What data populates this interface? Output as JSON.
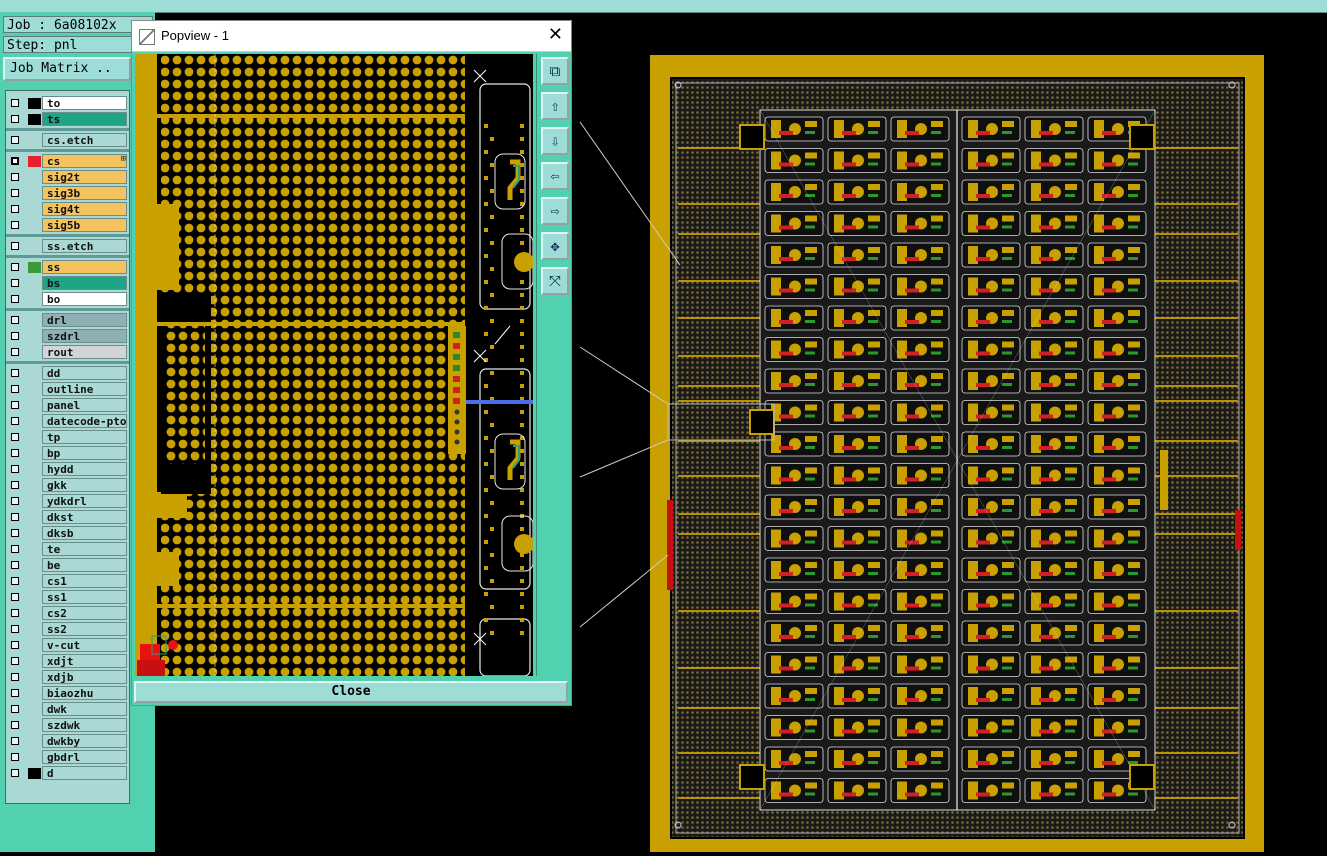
{
  "job_label": "Job : 6a08102x",
  "step_label": "Step: pnl",
  "job_matrix_button": "Job Matrix ..",
  "layers": [
    {
      "name": "to",
      "color": "#ffffff",
      "swatch": "#000000",
      "checked": false
    },
    {
      "name": "ts",
      "color": "#1ea586",
      "swatch": "#000000",
      "checked": false
    },
    {
      "name": "cs.etch",
      "color": "#a9d8d5",
      "swatch": "",
      "checked": false
    },
    {
      "name": "cs",
      "color": "#f5c260",
      "swatch": "#e8202b",
      "checked": true
    },
    {
      "name": "sig2t",
      "color": "#f5c260",
      "swatch": "",
      "checked": false
    },
    {
      "name": "sig3b",
      "color": "#f5c260",
      "swatch": "",
      "checked": false
    },
    {
      "name": "sig4t",
      "color": "#f5c260",
      "swatch": "",
      "checked": false
    },
    {
      "name": "sig5b",
      "color": "#f5c260",
      "swatch": "",
      "checked": false
    },
    {
      "name": "ss.etch",
      "color": "#a9d8d5",
      "swatch": "",
      "checked": false
    },
    {
      "name": "ss",
      "color": "#f5c260",
      "swatch": "#3a9a3a",
      "checked": false
    },
    {
      "name": "bs",
      "color": "#1ea586",
      "swatch": "",
      "checked": false
    },
    {
      "name": "bo",
      "color": "#ffffff",
      "swatch": "",
      "checked": false
    },
    {
      "name": "drl",
      "color": "#8fb0b4",
      "swatch": "",
      "checked": false
    },
    {
      "name": "szdrl",
      "color": "#8fb0b4",
      "swatch": "",
      "checked": false
    },
    {
      "name": "rout",
      "color": "#d4d4d4",
      "swatch": "",
      "checked": false
    },
    {
      "name": "dd",
      "color": "#a9d8d5",
      "swatch": "",
      "checked": false
    },
    {
      "name": "outline",
      "color": "#a9d8d5",
      "swatch": "",
      "checked": false
    },
    {
      "name": "panel",
      "color": "#a9d8d5",
      "swatch": "",
      "checked": false
    },
    {
      "name": "datecode-pto",
      "color": "#a9d8d5",
      "swatch": "",
      "checked": false
    },
    {
      "name": "tp",
      "color": "#a9d8d5",
      "swatch": "",
      "checked": false
    },
    {
      "name": "bp",
      "color": "#a9d8d5",
      "swatch": "",
      "checked": false
    },
    {
      "name": "hydd",
      "color": "#a9d8d5",
      "swatch": "",
      "checked": false
    },
    {
      "name": "gkk",
      "color": "#a9d8d5",
      "swatch": "",
      "checked": false
    },
    {
      "name": "ydkdrl",
      "color": "#a9d8d5",
      "swatch": "",
      "checked": false
    },
    {
      "name": "dkst",
      "color": "#a9d8d5",
      "swatch": "",
      "checked": false
    },
    {
      "name": "dksb",
      "color": "#a9d8d5",
      "swatch": "",
      "checked": false
    },
    {
      "name": "te",
      "color": "#a9d8d5",
      "swatch": "",
      "checked": false
    },
    {
      "name": "be",
      "color": "#a9d8d5",
      "swatch": "",
      "checked": false
    },
    {
      "name": "cs1",
      "color": "#a9d8d5",
      "swatch": "",
      "checked": false
    },
    {
      "name": "ss1",
      "color": "#a9d8d5",
      "swatch": "",
      "checked": false
    },
    {
      "name": "cs2",
      "color": "#a9d8d5",
      "swatch": "",
      "checked": false
    },
    {
      "name": "ss2",
      "color": "#a9d8d5",
      "swatch": "",
      "checked": false
    },
    {
      "name": "v-cut",
      "color": "#a9d8d5",
      "swatch": "",
      "checked": false
    },
    {
      "name": "xdjt",
      "color": "#a9d8d5",
      "swatch": "",
      "checked": false
    },
    {
      "name": "xdjb",
      "color": "#a9d8d5",
      "swatch": "",
      "checked": false
    },
    {
      "name": "biaozhu",
      "color": "#a9d8d5",
      "swatch": "",
      "checked": false
    },
    {
      "name": "dwk",
      "color": "#a9d8d5",
      "swatch": "",
      "checked": false
    },
    {
      "name": "szdwk",
      "color": "#a9d8d5",
      "swatch": "",
      "checked": false
    },
    {
      "name": "dwkby",
      "color": "#a9d8d5",
      "swatch": "",
      "checked": false
    },
    {
      "name": "gbdrl",
      "color": "#a9d8d5",
      "swatch": "",
      "checked": false
    },
    {
      "name": "d",
      "color": "#a9d8d5",
      "swatch": "#000000",
      "checked": false
    }
  ],
  "popview": {
    "title": "Popview - 1",
    "close_x": "✕",
    "close_button": "Close",
    "tools": [
      "zoom-fit-icon",
      "pan-up-icon",
      "pan-down-icon",
      "pan-left-icon",
      "pan-right-icon",
      "zoom-in-icon",
      "zoom-out-icon"
    ]
  },
  "colors": {
    "copper": "#c8a000",
    "board_bg": "#000000",
    "panel_teal": "#52d1b0"
  }
}
